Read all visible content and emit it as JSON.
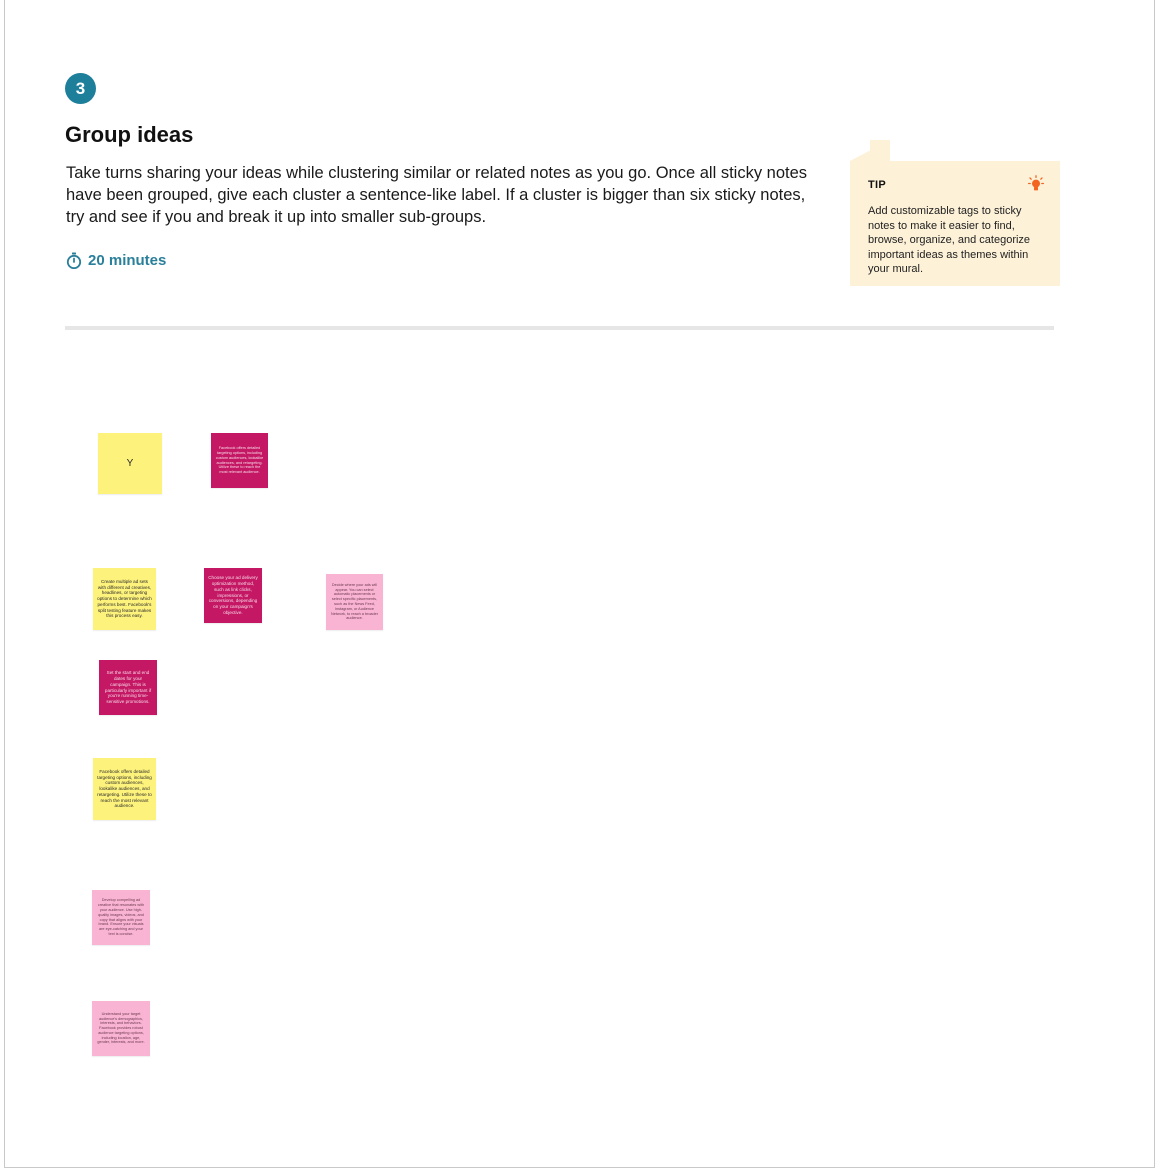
{
  "step": {
    "number": "3",
    "title": "Group ideas",
    "description": "Take turns sharing your ideas while clustering similar or related notes as you go. Once all sticky notes have been grouped, give each cluster a sentence-like label. If a cluster is bigger than six sticky notes, try and see if you and break it up into smaller sub-groups.",
    "duration": "20 minutes"
  },
  "tip": {
    "label": "TIP",
    "text": "Add customizable tags to sticky notes to make it easier to find, browse, organize, and categorize important ideas as themes within your mural.",
    "icon": "lightbulb-icon",
    "accent_color": "#f26522"
  },
  "colors": {
    "badge": "#1e7f9b",
    "timer": "#2a7f9b",
    "tip_background": "#fdf1d8",
    "sticky_yellow": "#fdf27c",
    "sticky_magenta": "#c41865",
    "sticky_pink": "#f9b3d3"
  },
  "stickies": [
    {
      "text": "Y"
    },
    {
      "text": "Facebook offers detailed targeting options, including custom audiences, lookalike audiences, and retargeting. Utilize these to reach the most relevant audience."
    },
    {
      "text": "Create multiple ad sets with different ad creatives, headlines, or targeting options to determine which performs best. Facebook's split testing feature makes this process easy."
    },
    {
      "text": "Choose your ad delivery optimization method, such as link clicks, impressions, or conversions, depending on your campaign's objective."
    },
    {
      "text": "Decide where your ads will appear. You can select automatic placements or select specific placements, such as the News Feed, Instagram, or Audience Network, to reach a broader audience."
    },
    {
      "text": "Set the start and end dates for your campaign. This is particularly important if you're running time-sensitive promotions."
    },
    {
      "text": "Facebook offers detailed targeting options, including custom audiences, lookalike audiences, and retargeting. Utilize these to reach the most relevant audience."
    },
    {
      "text": "Develop compelling ad creative that resonates with your audience. Use high-quality images, videos, and copy that aligns with your brand. Ensure your visuals are eye-catching and your text is concise."
    },
    {
      "text": "Understand your target audience's demographics, interests, and behaviors. Facebook provides robust audience targeting options, including location, age, gender, interests, and more."
    }
  ]
}
